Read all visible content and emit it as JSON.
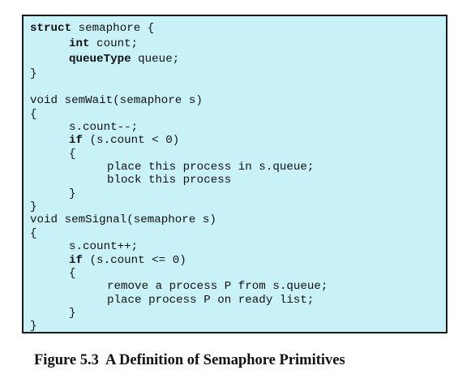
{
  "code": {
    "l01": [
      "struct",
      " semaphore {"
    ],
    "l02": [
      "int",
      " count;"
    ],
    "l03": [
      "queueType",
      " queue;"
    ],
    "l04": "}",
    "l05": "void semWait(semaphore s)",
    "l06": "{",
    "l07": "s.count--;",
    "l08": [
      "if",
      " (s.count < 0)"
    ],
    "l09": "{",
    "l10": "place this process in s.queue;",
    "l11": "block this process",
    "l12": "}",
    "l13": "}",
    "l14": "void semSignal(semaphore s)",
    "l15": "{",
    "l16": "s.count++;",
    "l17": [
      "if",
      " (s.count <= 0)"
    ],
    "l18": "{",
    "l19": "remove a process P from s.queue;",
    "l20": "place process P on ready list;",
    "l21": "}",
    "l22": "}"
  },
  "caption": "Figure 5.3  A Definition of Semaphore Primitives"
}
